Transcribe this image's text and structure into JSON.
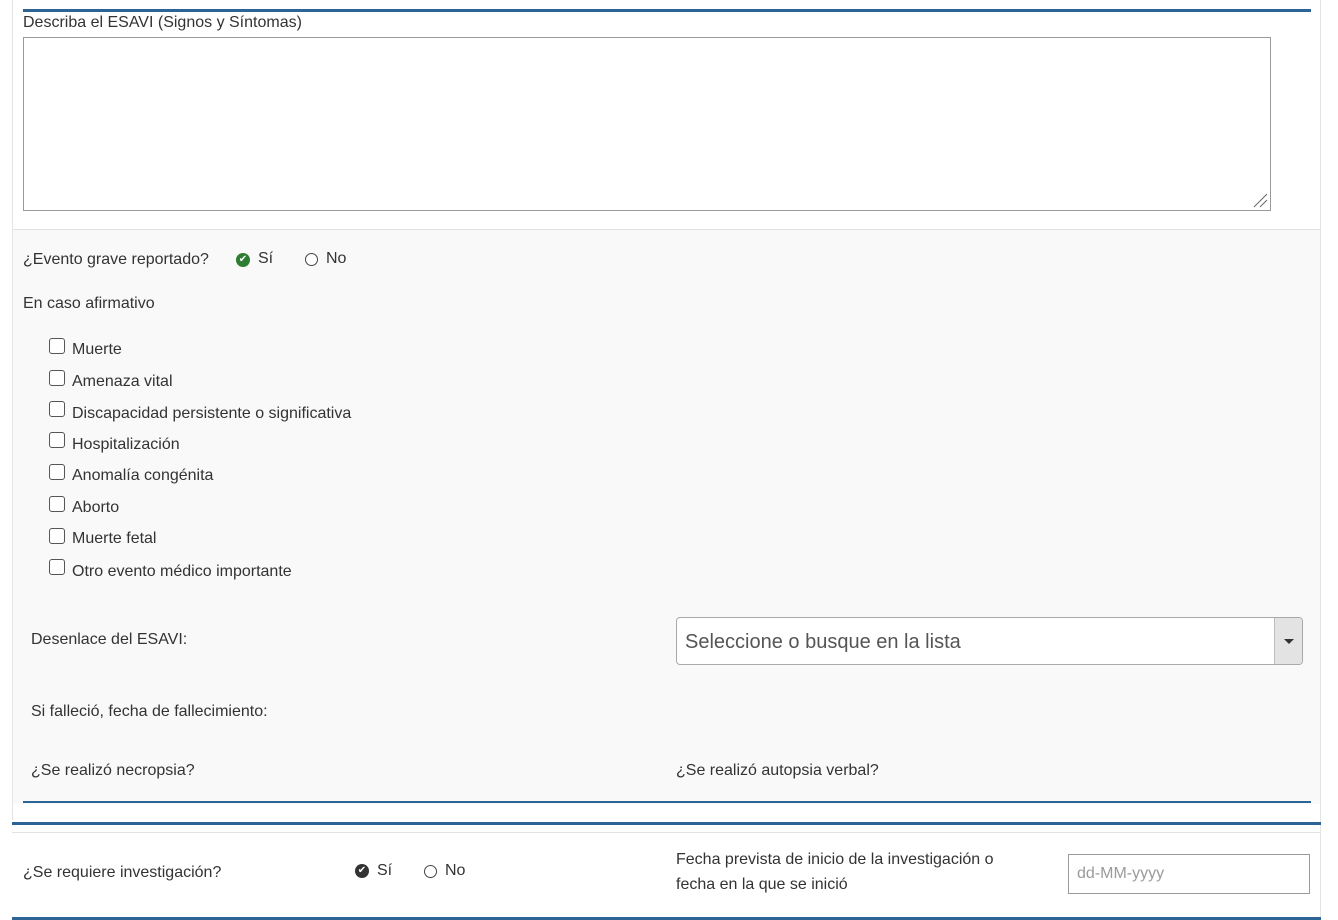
{
  "description": {
    "label": "Describa el ESAVI (Signos y Síntomas)",
    "value": ""
  },
  "serious_event": {
    "question": "¿Evento grave reportado?",
    "yes_label": "Sí",
    "no_label": "No",
    "selected": "Sí"
  },
  "affirmative": {
    "heading": "En caso afirmativo",
    "options": [
      "Muerte",
      "Amenaza vital",
      "Discapacidad persistente o significativa",
      "Hospitalización",
      "Anomalía congénita",
      "Aborto",
      "Muerte fetal",
      "Otro evento médico importante"
    ]
  },
  "outcome": {
    "label": "Desenlace del ESAVI:",
    "placeholder": "Seleccione o busque en la lista"
  },
  "death_date": {
    "label": "Si falleció, fecha de fallecimiento:"
  },
  "necropsy": {
    "label": "¿Se realizó necropsia?"
  },
  "verbal_autopsy": {
    "label": "¿Se realizó autopsia verbal?"
  },
  "investigation": {
    "question": "¿Se requiere investigación?",
    "yes_label": "Sí",
    "no_label": "No",
    "selected": "Sí",
    "date_label_line1": "Fecha prevista de inicio de la investigación o",
    "date_label_line2": "fecha en la que se inició",
    "date_placeholder": "dd-MM-yyyy"
  },
  "colors": {
    "accent_line": "#2d6496",
    "check_green": "#2e7d32"
  }
}
